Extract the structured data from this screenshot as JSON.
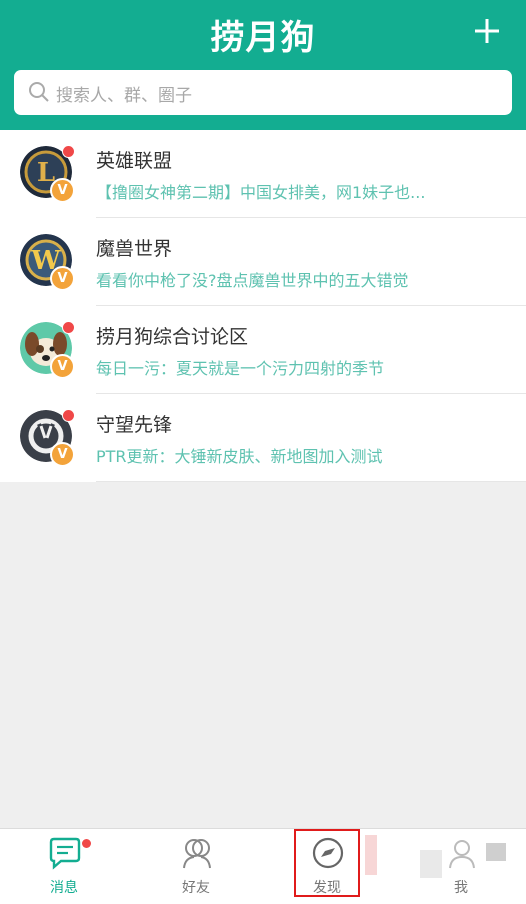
{
  "header": {
    "title": "捞月狗",
    "plus_label": "+"
  },
  "search": {
    "placeholder": "搜索人、群、圈子"
  },
  "circles": [
    {
      "name": "英雄联盟",
      "preview": "【撸圈女神第二期】中国女排美，网1妹子也...",
      "unread": true,
      "avatar_letter": "L"
    },
    {
      "name": "魔兽世界",
      "preview": "看看你中枪了没?盘点魔兽世界中的五大错觉",
      "unread": false,
      "avatar_letter": "W"
    },
    {
      "name": "捞月狗综合讨论区",
      "preview": "每日一污：夏天就是一个污力四射的季节",
      "unread": true,
      "avatar_letter": ""
    },
    {
      "name": "守望先锋",
      "preview": "PTR更新：大锤新皮肤、新地图加入测试",
      "unread": true,
      "avatar_letter": ""
    }
  ],
  "badge_label": "V",
  "tabs": [
    {
      "label": "消息",
      "active": true
    },
    {
      "label": "好友",
      "active": false
    },
    {
      "label": "发现",
      "active": false
    },
    {
      "label": "我",
      "active": false
    }
  ],
  "colors": {
    "brand": "#13ad91",
    "unread_dot": "#f04848",
    "badge": "#f3a33a",
    "highlight_box": "#e01b1b"
  }
}
